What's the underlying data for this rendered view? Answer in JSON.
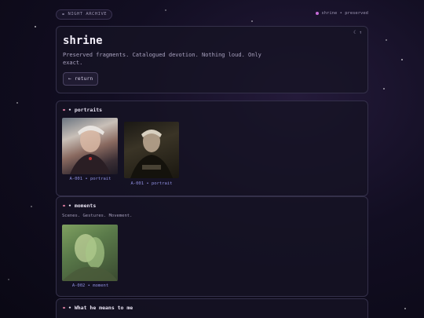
{
  "topbar": {
    "archive_label": "NIGHT ARCHIVE",
    "status": "shrine • preserved"
  },
  "hero": {
    "title": "shrine",
    "description": "Preserved fragments. Catalogued devotion. Nothing loud. Only exact.",
    "icons": "☾ ↑",
    "return_label": "← return"
  },
  "sections": {
    "portraits": {
      "title": "• portraits",
      "captions": [
        "A-001 • portrait",
        "A-001 • portrait"
      ]
    },
    "moments": {
      "title": "• moments",
      "subtitle": "Scenes. Gestures. Movement.",
      "captions": [
        "A-002 • moment"
      ]
    },
    "meaning": {
      "title": "• What he means to me"
    }
  },
  "icons": {
    "eye": "eye-icon",
    "dot": "status-dot-icon",
    "moon": "moon-icon",
    "arrow": "arrow-up-icon"
  },
  "colors": {
    "accent": "#c56bd6",
    "caption": "#8f8fe0",
    "background": "#120e22"
  }
}
